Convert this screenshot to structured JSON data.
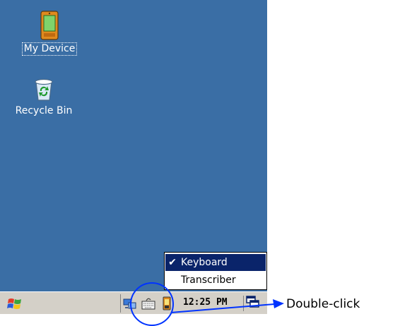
{
  "desktop": {
    "icons": [
      {
        "label": "My Device",
        "icon": "pda-device-icon",
        "selected": true
      },
      {
        "label": "Recycle Bin",
        "icon": "recycle-bin-icon",
        "selected": false
      }
    ]
  },
  "input_menu": {
    "items": [
      {
        "label": "Keyboard",
        "checked": true,
        "check_glyph": "✔"
      },
      {
        "label": "Transcriber",
        "checked": false,
        "check_glyph": ""
      }
    ]
  },
  "taskbar": {
    "start_icon": "windows-flag-icon",
    "tray_icons": [
      "network-icon",
      "keyboard-input-icon",
      "battery-icon"
    ],
    "clock": "12:25 PM",
    "desktop_icon": "show-desktop-icon"
  },
  "annotation": {
    "text": "Double-click",
    "color": "#0033ff"
  },
  "colors": {
    "desktop": "#3a6ea5",
    "taskbar": "#d4d0c8",
    "highlight": "#0a246a"
  }
}
